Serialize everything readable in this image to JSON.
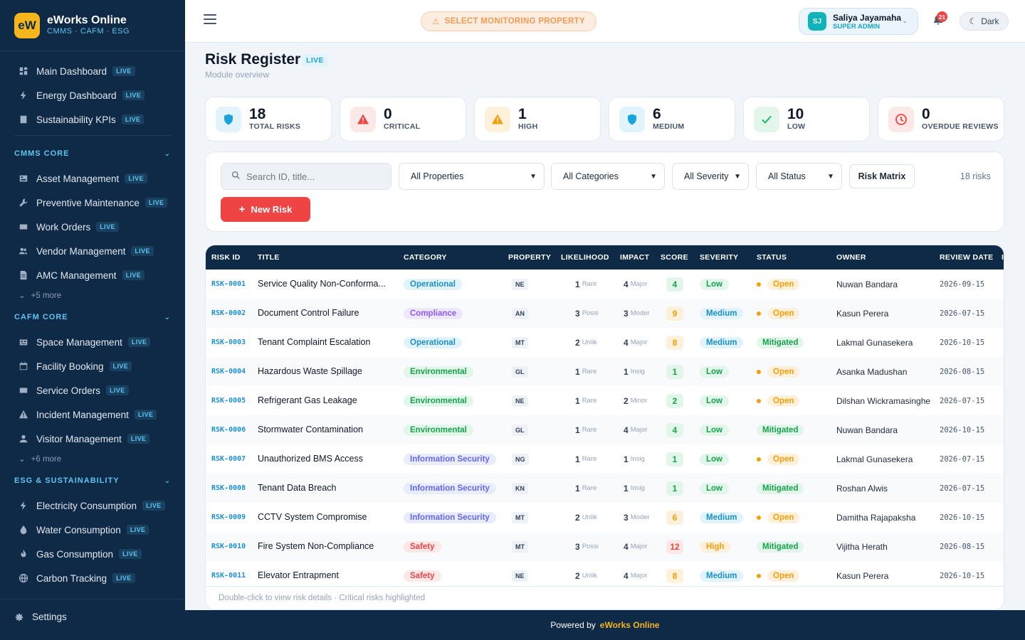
{
  "brand": {
    "logo": "eW",
    "name": "eWorks Online",
    "tagline": "CMMS · CAFM · ESG"
  },
  "live_label": "LIVE",
  "sidebar": {
    "top": [
      {
        "label": "Main Dashboard",
        "icon": "dashboard-icon"
      },
      {
        "label": "Energy Dashboard",
        "icon": "bolt-icon"
      },
      {
        "label": "Sustainability KPIs",
        "icon": "chart-icon"
      }
    ],
    "sections": [
      {
        "title": "CMMS CORE",
        "items": [
          {
            "label": "Asset Management",
            "icon": "asset-icon"
          },
          {
            "label": "Preventive Maintenance",
            "icon": "wrench-icon"
          },
          {
            "label": "Work Orders",
            "icon": "clipboard-icon"
          },
          {
            "label": "Vendor Management",
            "icon": "people-icon"
          },
          {
            "label": "AMC Management",
            "icon": "document-icon"
          }
        ],
        "more": "+5 more"
      },
      {
        "title": "CAFM CORE",
        "items": [
          {
            "label": "Space Management",
            "icon": "building-icon"
          },
          {
            "label": "Facility Booking",
            "icon": "calendar-icon"
          },
          {
            "label": "Service Orders",
            "icon": "tray-icon"
          },
          {
            "label": "Incident Management",
            "icon": "warning-icon"
          },
          {
            "label": "Visitor Management",
            "icon": "person-icon"
          }
        ],
        "more": "+6 more"
      },
      {
        "title": "ESG & SUSTAINABILITY",
        "items": [
          {
            "label": "Electricity Consumption",
            "icon": "bolt-icon"
          },
          {
            "label": "Water Consumption",
            "icon": "drop-icon"
          },
          {
            "label": "Gas Consumption",
            "icon": "flame-icon"
          },
          {
            "label": "Carbon Tracking",
            "icon": "globe-icon"
          }
        ]
      }
    ],
    "settings": "Settings"
  },
  "topbar": {
    "monitor": "SELECT MONITORING PROPERTY",
    "user_initials": "SJ",
    "user_name": "Saliya Jayamaha",
    "user_role": "SUPER ADMIN",
    "notif_count": "21",
    "theme": "Dark"
  },
  "page": {
    "title": "Risk Register",
    "subtitle": "Module overview"
  },
  "stats": [
    {
      "value": "18",
      "label": "TOTAL RISKS",
      "color": "#1ba3dc",
      "bg": "#e1f3fb",
      "icon": "shield-icon"
    },
    {
      "value": "0",
      "label": "CRITICAL",
      "color": "#ef4444",
      "bg": "#fde8e8",
      "icon": "alert-icon"
    },
    {
      "value": "1",
      "label": "HIGH",
      "color": "#f59e0b",
      "bg": "#fdf1dc",
      "icon": "warning-icon"
    },
    {
      "value": "6",
      "label": "MEDIUM",
      "color": "#1ba3dc",
      "bg": "#e1f3fb",
      "icon": "shield-icon"
    },
    {
      "value": "10",
      "label": "LOW",
      "color": "#22b573",
      "bg": "#e3f6ec",
      "icon": "check-icon"
    },
    {
      "value": "0",
      "label": "OVERDUE REVIEWS",
      "color": "#ef4444",
      "bg": "#fde8e8",
      "icon": "clock-icon"
    }
  ],
  "filters": {
    "search_placeholder": "Search ID, title...",
    "properties": "All Properties",
    "categories": "All Categories",
    "severity": "All Severity",
    "status": "All Status",
    "matrix": "Risk Matrix",
    "count": "18 risks",
    "new_risk": "New Risk"
  },
  "table": {
    "headers": [
      "RISK ID",
      "TITLE",
      "CATEGORY",
      "PROPERTY",
      "LIKELIHOOD",
      "IMPACT",
      "SCORE",
      "SEVERITY",
      "STATUS",
      "OWNER",
      "REVIEW DATE",
      "I"
    ],
    "rows": [
      {
        "id": "RSK-0001",
        "title": "Service Quality Non-Conforma...",
        "category": "Operational",
        "property": "NE",
        "likelihood": "1",
        "likelihood_label": "Rare",
        "impact": "4",
        "impact_label": "Major",
        "score": "4",
        "severity": "Low",
        "status": "Open",
        "owner": "Nuwan Bandara",
        "date": "2026-09-15"
      },
      {
        "id": "RSK-0002",
        "title": "Document Control Failure",
        "category": "Compliance",
        "property": "AN",
        "likelihood": "3",
        "likelihood_label": "Possi",
        "impact": "3",
        "impact_label": "Moder",
        "score": "9",
        "severity": "Medium",
        "status": "Open",
        "owner": "Kasun Perera",
        "date": "2026-07-15"
      },
      {
        "id": "RSK-0003",
        "title": "Tenant Complaint Escalation",
        "category": "Operational",
        "property": "MT",
        "likelihood": "2",
        "likelihood_label": "Unlik",
        "impact": "4",
        "impact_label": "Major",
        "score": "8",
        "severity": "Medium",
        "status": "Mitigated",
        "owner": "Lakmal Gunasekera",
        "date": "2026-10-15"
      },
      {
        "id": "RSK-0004",
        "title": "Hazardous Waste Spillage",
        "category": "Environmental",
        "property": "GL",
        "likelihood": "1",
        "likelihood_label": "Rare",
        "impact": "1",
        "impact_label": "Insig",
        "score": "1",
        "severity": "Low",
        "status": "Open",
        "owner": "Asanka Madushan",
        "date": "2026-08-15"
      },
      {
        "id": "RSK-0005",
        "title": "Refrigerant Gas Leakage",
        "category": "Environmental",
        "property": "NE",
        "likelihood": "1",
        "likelihood_label": "Rare",
        "impact": "2",
        "impact_label": "Minor",
        "score": "2",
        "severity": "Low",
        "status": "Open",
        "owner": "Dilshan Wickramasinghe",
        "date": "2026-07-15"
      },
      {
        "id": "RSK-0006",
        "title": "Stormwater Contamination",
        "category": "Environmental",
        "property": "GL",
        "likelihood": "1",
        "likelihood_label": "Rare",
        "impact": "4",
        "impact_label": "Major",
        "score": "4",
        "severity": "Low",
        "status": "Mitigated",
        "owner": "Nuwan Bandara",
        "date": "2026-10-15"
      },
      {
        "id": "RSK-0007",
        "title": "Unauthorized BMS Access",
        "category": "Information Security",
        "property": "NG",
        "likelihood": "1",
        "likelihood_label": "Rare",
        "impact": "1",
        "impact_label": "Insig",
        "score": "1",
        "severity": "Low",
        "status": "Open",
        "owner": "Lakmal Gunasekera",
        "date": "2026-07-15"
      },
      {
        "id": "RSK-0008",
        "title": "Tenant Data Breach",
        "category": "Information Security",
        "property": "KN",
        "likelihood": "1",
        "likelihood_label": "Rare",
        "impact": "1",
        "impact_label": "Insig",
        "score": "1",
        "severity": "Low",
        "status": "Mitigated",
        "owner": "Roshan Alwis",
        "date": "2026-07-15"
      },
      {
        "id": "RSK-0009",
        "title": "CCTV System Compromise",
        "category": "Information Security",
        "property": "MT",
        "likelihood": "2",
        "likelihood_label": "Unlik",
        "impact": "3",
        "impact_label": "Moder",
        "score": "6",
        "severity": "Medium",
        "status": "Open",
        "owner": "Damitha Rajapaksha",
        "date": "2026-10-15"
      },
      {
        "id": "RSK-0010",
        "title": "Fire System Non-Compliance",
        "category": "Safety",
        "property": "MT",
        "likelihood": "3",
        "likelihood_label": "Possi",
        "impact": "4",
        "impact_label": "Major",
        "score": "12",
        "severity": "High",
        "status": "Mitigated",
        "owner": "Vijitha Herath",
        "date": "2026-08-15"
      },
      {
        "id": "RSK-0011",
        "title": "Elevator Entrapment",
        "category": "Safety",
        "property": "NE",
        "likelihood": "2",
        "likelihood_label": "Unlik",
        "impact": "4",
        "impact_label": "Major",
        "score": "8",
        "severity": "Medium",
        "status": "Open",
        "owner": "Kasun Perera",
        "date": "2026-10-15"
      }
    ],
    "footnote": "Double-click to view risk details · Critical risks highlighted"
  },
  "footer": {
    "prefix": "Powered by",
    "brand": "eWorks Online"
  }
}
